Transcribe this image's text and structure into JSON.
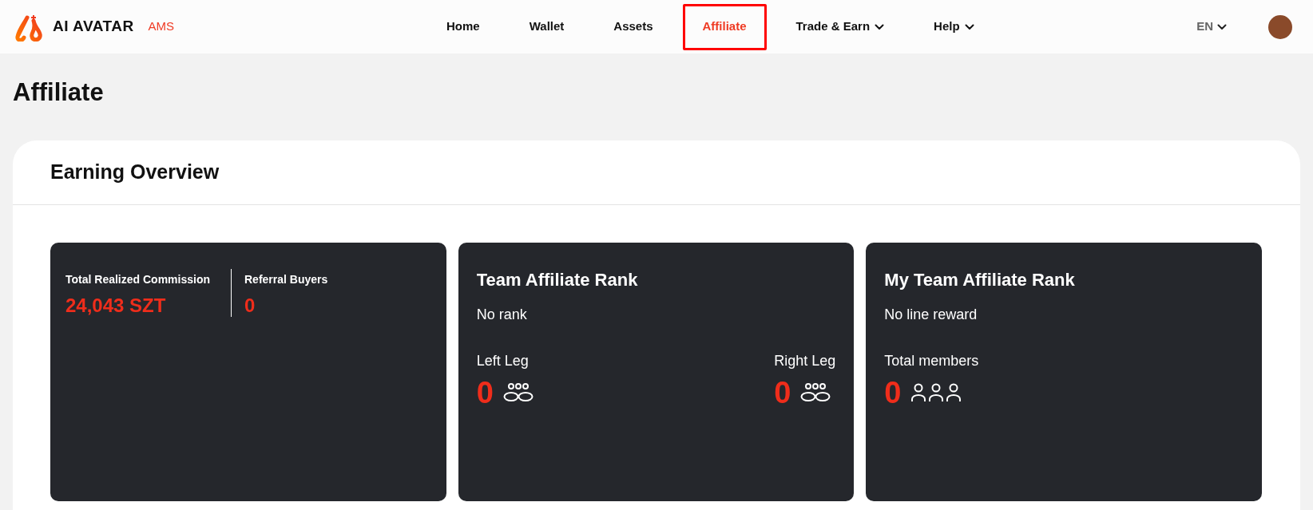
{
  "header": {
    "brand": "AI AVATAR",
    "brand_tag": "AMS",
    "nav": [
      {
        "label": "Home",
        "selected": false,
        "has_menu": false
      },
      {
        "label": "Wallet",
        "selected": false,
        "has_menu": false
      },
      {
        "label": "Assets",
        "selected": false,
        "has_menu": false
      },
      {
        "label": "Affiliate",
        "selected": true,
        "has_menu": false
      },
      {
        "label": "Trade & Earn",
        "selected": false,
        "has_menu": true
      },
      {
        "label": "Help",
        "selected": false,
        "has_menu": true
      }
    ],
    "language": "EN"
  },
  "page_title": "Affiliate",
  "overview": {
    "title": "Earning Overview",
    "cards": [
      {
        "kind": "stats",
        "stats": [
          {
            "label": "Total Realized Commission",
            "value": "24,043 SZT"
          },
          {
            "label": "Referral Buyers",
            "value": "0"
          }
        ]
      },
      {
        "kind": "legs",
        "title": "Team Affiliate Rank",
        "subtitle": "No rank",
        "legs": [
          {
            "label": "Left Leg",
            "value": "0"
          },
          {
            "label": "Right Leg",
            "value": "0"
          }
        ]
      },
      {
        "kind": "members",
        "title": "My Team Affiliate Rank",
        "subtitle": "No line reward",
        "label": "Total members",
        "value": "0"
      }
    ]
  }
}
